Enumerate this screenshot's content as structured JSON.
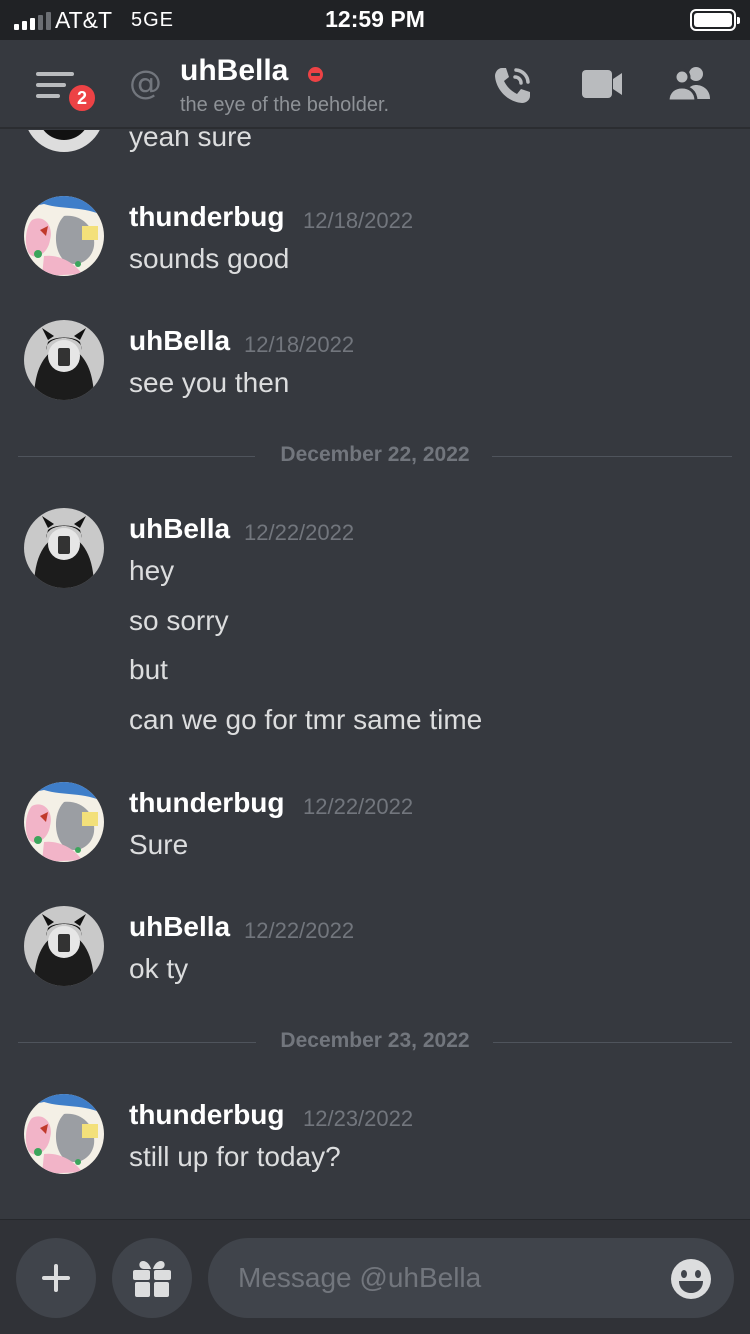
{
  "status_bar": {
    "carrier": "AT&T",
    "network": "5GE",
    "time": "12:59 PM"
  },
  "header": {
    "unread_badge": "2",
    "at_symbol": "@",
    "channel_name": "uhBella",
    "status_color": "#ed4245",
    "topic": "the eye of the beholder.",
    "icons": [
      "menu-icon",
      "phone-call-icon",
      "video-camera-icon",
      "members-icon"
    ]
  },
  "messages": [
    {
      "type": "partial",
      "author": "uhBella",
      "lines": [
        "yeah sure"
      ]
    },
    {
      "type": "message",
      "author": "thunderbug",
      "timestamp": "12/18/2022",
      "lines": [
        "sounds good"
      ]
    },
    {
      "type": "message",
      "author": "uhBella",
      "timestamp": "12/18/2022",
      "lines": [
        "see you then"
      ]
    },
    {
      "type": "divider",
      "label": "December 22, 2022"
    },
    {
      "type": "message",
      "author": "uhBella",
      "timestamp": "12/22/2022",
      "lines": [
        "hey",
        "so sorry",
        "but",
        "can we go for tmr same time"
      ]
    },
    {
      "type": "message",
      "author": "thunderbug",
      "timestamp": "12/22/2022",
      "lines": [
        "Sure"
      ]
    },
    {
      "type": "message",
      "author": "uhBella",
      "timestamp": "12/22/2022",
      "lines": [
        "ok ty"
      ]
    },
    {
      "type": "divider",
      "label": "December 23, 2022"
    },
    {
      "type": "message",
      "author": "thunderbug",
      "timestamp": "12/23/2022",
      "lines": [
        "still up for today?"
      ]
    }
  ],
  "composer": {
    "placeholder": "Message @uhBella",
    "icons": [
      "plus-icon",
      "gift-icon",
      "emoji-icon"
    ]
  },
  "colors": {
    "background": "#36393f",
    "header": "#36393f",
    "input": "#40444b",
    "muted": "#72767d",
    "danger": "#ed4245"
  }
}
